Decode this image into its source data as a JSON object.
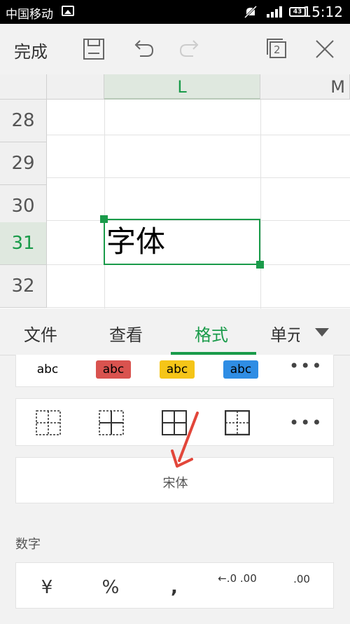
{
  "status": {
    "carrier": "中国移动",
    "time": "15:12",
    "battery": "43"
  },
  "toolbar": {
    "done_label": "完成",
    "sheet_count": "2"
  },
  "grid": {
    "columns": [
      "L",
      "M"
    ],
    "rows": [
      "28",
      "29",
      "30",
      "31",
      "32"
    ],
    "selected_row": "31",
    "selected_cell_text": "字体"
  },
  "tabs": [
    {
      "label": "文件"
    },
    {
      "label": "查看"
    },
    {
      "label": "格式"
    },
    {
      "label": "单元"
    }
  ],
  "text_styles": [
    {
      "label": "abc",
      "bg": "#ffffff",
      "color": "#000000"
    },
    {
      "label": "abc",
      "bg": "#d9534f",
      "color": "#111111"
    },
    {
      "label": "abc",
      "bg": "#f5c518",
      "color": "#111111"
    },
    {
      "label": "abc",
      "bg": "#2f8de4",
      "color": "#111111"
    }
  ],
  "font": {
    "name": "宋体"
  },
  "number_section": {
    "title": "数字",
    "buttons": [
      "¥",
      "%",
      ",",
      "←.0 .00",
      ".00"
    ]
  },
  "colors": {
    "accent": "#1a9b4a",
    "arrow": "#e2463a"
  }
}
